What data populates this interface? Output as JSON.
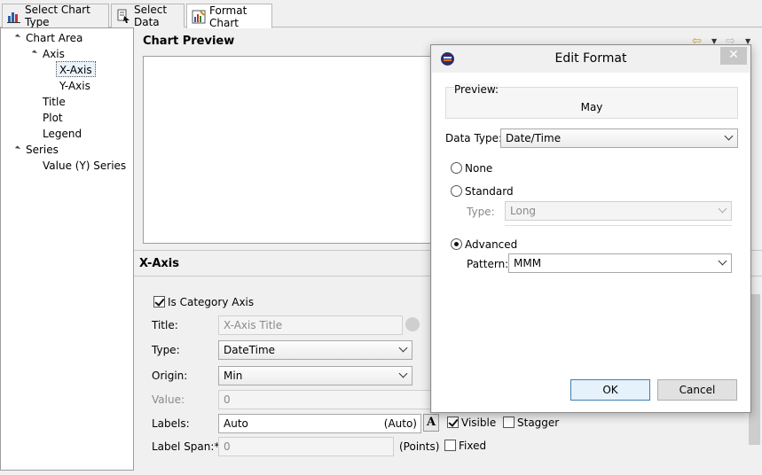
{
  "tabs": [
    {
      "label": "Select Chart Type",
      "icon": "chart-type-icon"
    },
    {
      "label": "Select Data",
      "icon": "select-data-icon"
    },
    {
      "label": "Format Chart",
      "icon": "format-chart-icon"
    }
  ],
  "tree": {
    "chart_area": "Chart Area",
    "axis": "Axis",
    "x_axis": "X-Axis",
    "y_axis": "Y-Axis",
    "title": "Title",
    "plot": "Plot",
    "legend": "Legend",
    "series": "Series",
    "value_series": "Value (Y) Series"
  },
  "preview": {
    "title": "Chart Preview"
  },
  "xaxis": {
    "header": "X-Axis",
    "is_category_label": "Is Category Axis",
    "is_category_checked": true,
    "title_label": "Title:",
    "title_value": "X-Axis Title",
    "type_label": "Type:",
    "type_value": "DateTime",
    "origin_label": "Origin:",
    "origin_value": "Min",
    "value_label": "Value:",
    "value_value": "0",
    "labels_label": "Labels:",
    "labels_value": "Auto",
    "labels_auto": "(Auto)",
    "font_button": "A",
    "visible_label": "Visible",
    "visible_checked": true,
    "stagger_label": "Stagger",
    "stagger_checked": false,
    "label_span_label": "Label Span:*",
    "label_span_value": "0",
    "points_label": "(Points)",
    "fixed_label": "Fixed",
    "fixed_checked": false
  },
  "dialog": {
    "title": "Edit Format",
    "close": "✕",
    "preview_label": "Preview:",
    "preview_value": "May",
    "data_type_label": "Data Type:",
    "data_type_value": "Date/Time",
    "none_label": "None",
    "standard_label": "Standard",
    "type_label": "Type:",
    "type_value": "Long",
    "advanced_label": "Advanced",
    "pattern_label": "Pattern:",
    "pattern_value": "MMM",
    "selected_option": "Advanced",
    "ok": "OK",
    "cancel": "Cancel"
  }
}
